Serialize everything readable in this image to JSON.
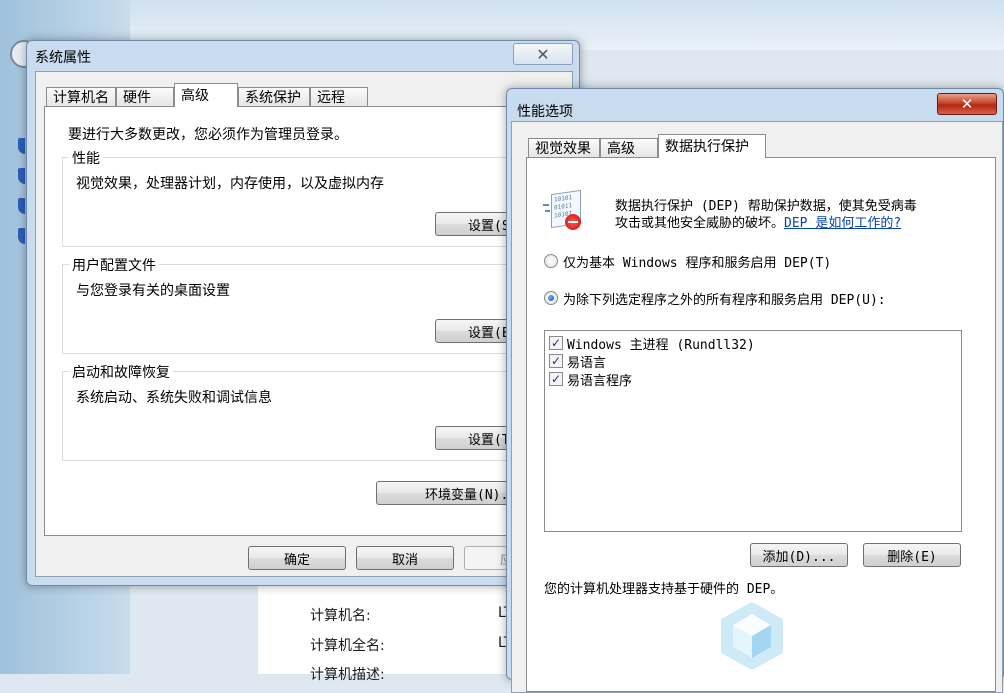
{
  "system_properties": {
    "title": "系统属性",
    "tabs": [
      "计算机名",
      "硬件",
      "高级",
      "系统保护",
      "远程"
    ],
    "active_tab": "高级",
    "admin_note": "要进行大多数更改，您必须作为管理员登录。",
    "groups": [
      {
        "title": "性能",
        "desc": "视觉效果，处理器计划，内存使用，以及虚拟内存",
        "button": "设置(S)..."
      },
      {
        "title": "用户配置文件",
        "desc": "与您登录有关的桌面设置",
        "button": "设置(E)..."
      },
      {
        "title": "启动和故障恢复",
        "desc": "系统启动、系统失败和调试信息",
        "button": "设置(T)..."
      }
    ],
    "env_button": "环境变量(N)...",
    "ok": "确定",
    "cancel": "取消",
    "apply": "应用"
  },
  "performance_options": {
    "title": "性能选项",
    "close_glyph": "✕",
    "tabs": [
      "视觉效果",
      "高级",
      "数据执行保护"
    ],
    "active_tab": "数据执行保护",
    "dep_desc_line1": "数据执行保护 (DEP) 帮助保护数据，使其免受病毒",
    "dep_desc_line2": "攻击或其他安全威胁的破坏。",
    "dep_link": "DEP 是如何工作的?",
    "icon_text_lines": [
      "10101",
      "01011",
      "10101"
    ],
    "radio_basic": "仅为基本 Windows 程序和服务启用 DEP(T)",
    "radio_all_except": "为除下列选定程序之外的所有程序和服务启用 DEP(U):",
    "selected_option": "all_except",
    "programs": [
      {
        "name": "Windows 主进程 (Rundll32)",
        "checked": true
      },
      {
        "name": "易语言",
        "checked": true
      },
      {
        "name": "易语言程序",
        "checked": true
      }
    ],
    "add_button": "添加(D)...",
    "remove_button": "删除(E)",
    "hardware_note": "您的计算机处理器支持基于硬件的 DEP。"
  },
  "background": {
    "computer_name_label": "计算机名:",
    "computer_name_value": "LT",
    "full_name_label": "计算机全名:",
    "full_name_value": "LT",
    "desc_label": "计算机描述:"
  }
}
